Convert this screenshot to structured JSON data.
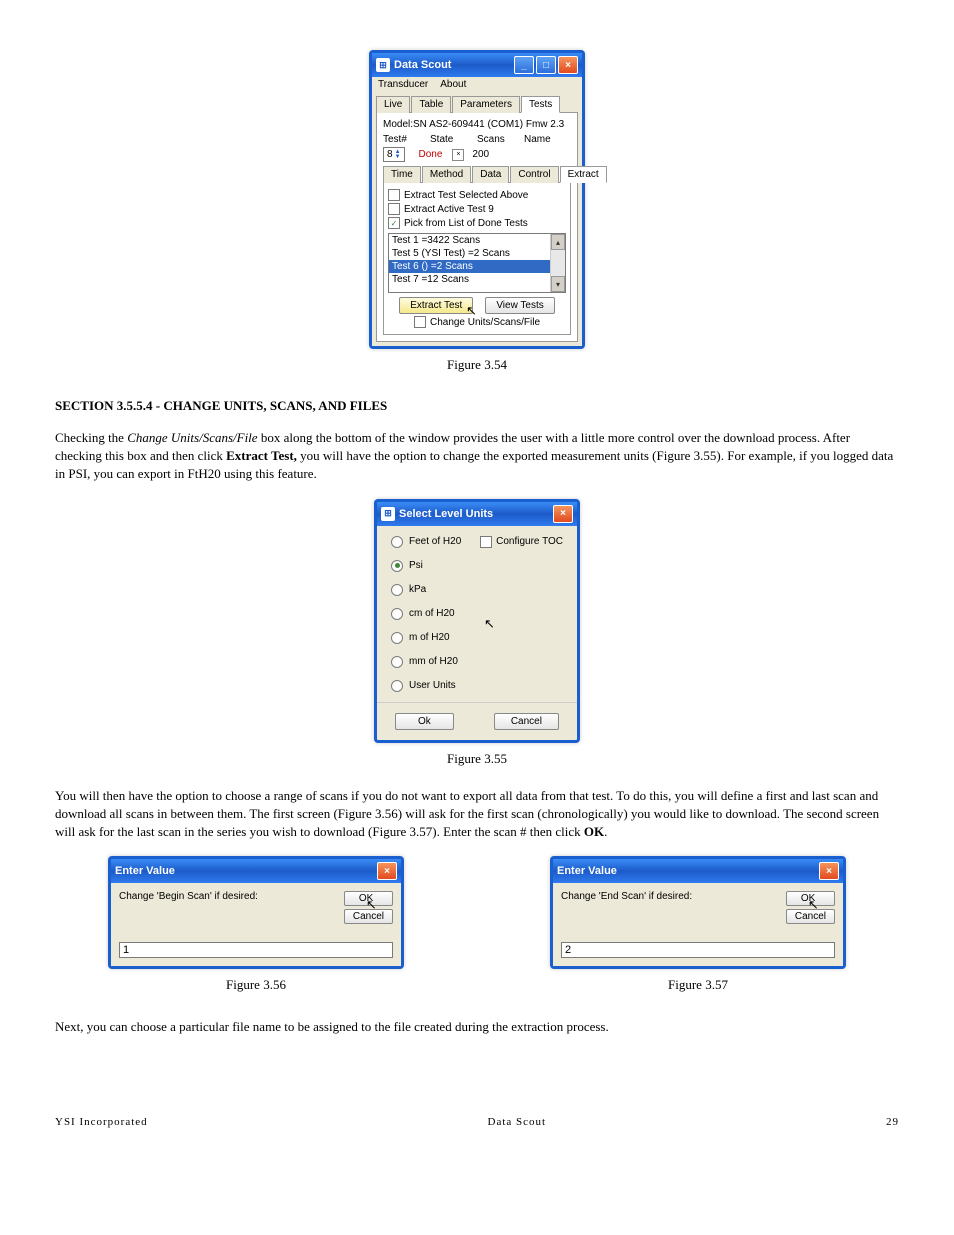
{
  "fig354": {
    "title": "Data Scout",
    "menu": [
      "Transducer",
      "About"
    ],
    "main_tabs": [
      "Live",
      "Table",
      "Parameters",
      "Tests"
    ],
    "model_line": "Model:SN AS2-609441 (COM1) Fmw 2.3",
    "head": {
      "test": "Test#",
      "state": "State",
      "scans": "Scans",
      "name": "Name"
    },
    "test_num": "8",
    "done": "Done",
    "scans": "200",
    "sub_tabs": [
      "Time",
      "Method",
      "Data",
      "Control",
      "Extract"
    ],
    "opt1": "Extract Test Selected Above",
    "opt2": "Extract Active Test 9",
    "opt3": "Pick from List of Done Tests",
    "list": [
      "Test 1 =3422 Scans",
      "Test 5 (YSI Test) =2 Scans",
      "Test 6 () =2 Scans",
      "Test 7 =12 Scans"
    ],
    "btn_extract": "Extract Test",
    "btn_view": "View Tests",
    "change_label": "Change Units/Scans/File",
    "caption": "Figure 3.54"
  },
  "section": {
    "heading": "SECTION 3.5.5.4 - CHANGE UNITS, SCANS, AND FILES",
    "p1a": "Checking the ",
    "p1b": "Change Units/Scans/File",
    "p1c": " box along the bottom of the window provides the user with a little more control over the download process.  After checking this box and then click ",
    "p1d": "Extract Test,",
    "p1e": " you will have the option to change the exported measurement units (Figure 3.55). For example, if you logged data in PSI, you can export in FtH20 using this feature."
  },
  "fig355": {
    "title": "Select Level Units",
    "options": [
      "Feet of H20",
      "Psi",
      "kPa",
      "cm of H20",
      "m of H20",
      "mm of H20",
      "User Units"
    ],
    "config": "Configure TOC",
    "ok": "Ok",
    "cancel": "Cancel",
    "caption": "Figure 3.55"
  },
  "p2a": "You will then have the option to choose a range of scans if you do not want to export all data from that test.  To do this, you will define a first and last scan and download all scans in between them. The first screen (Figure 3.56) will ask for the first scan (chronologically) you would like to download.  The second screen will ask for the last scan in the series you wish to download (Figure 3.57).  Enter the scan # then click ",
  "p2b": "OK",
  "p2c": ".",
  "fig356": {
    "title": "Enter Value",
    "prompt": "Change 'Begin Scan' if desired:",
    "ok": "OK",
    "cancel": "Cancel",
    "value": "1",
    "caption": "Figure 3.56"
  },
  "fig357": {
    "title": "Enter Value",
    "prompt": "Change 'End Scan' if desired:",
    "ok": "OK",
    "cancel": "Cancel",
    "value": "2",
    "caption": "Figure 3.57"
  },
  "p3": "Next, you can choose a particular file name to be assigned to the file created during the extraction process.",
  "footer": {
    "left": "YSI Incorporated",
    "center": "Data Scout",
    "right": "29"
  }
}
